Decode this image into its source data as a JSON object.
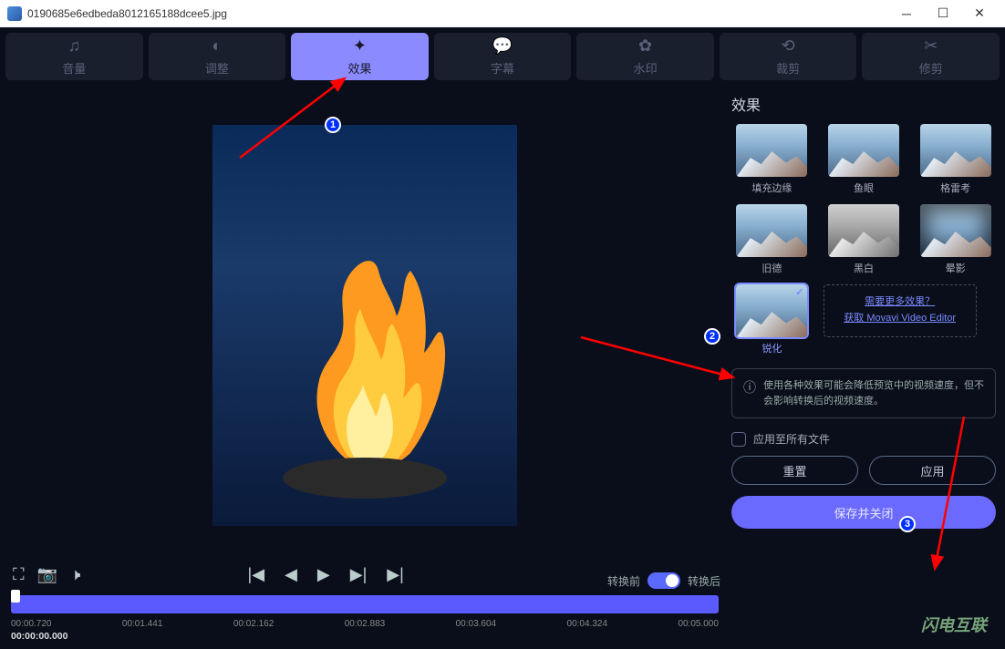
{
  "window": {
    "title": "0190685e6edbeda8012165188dcee5.jpg"
  },
  "tabs": [
    {
      "key": "volume",
      "label": "音量"
    },
    {
      "key": "adjust",
      "label": "调整"
    },
    {
      "key": "effects",
      "label": "效果"
    },
    {
      "key": "subtitle",
      "label": "字幕"
    },
    {
      "key": "watermark",
      "label": "水印"
    },
    {
      "key": "crop",
      "label": "裁剪"
    },
    {
      "key": "trim",
      "label": "修剪"
    }
  ],
  "toggle": {
    "before": "转换前",
    "after": "转换后"
  },
  "panel": {
    "title": "效果",
    "more1": "需要更多效果？",
    "more2": "获取 Movavi Video Editor",
    "notice": "使用各种效果可能会降低预览中的视频速度，但不会影响转换后的视频速度。",
    "applyAll": "应用至所有文件",
    "reset": "重置",
    "apply": "应用",
    "save": "保存并关闭"
  },
  "effects": [
    {
      "key": "fill",
      "label": "填充边缘"
    },
    {
      "key": "fisheye",
      "label": "鱼眼"
    },
    {
      "key": "greco",
      "label": "格雷考"
    },
    {
      "key": "old",
      "label": "旧德"
    },
    {
      "key": "bw",
      "label": "黑白"
    },
    {
      "key": "vignette",
      "label": "晕影"
    },
    {
      "key": "sharpen",
      "label": "锐化"
    }
  ],
  "timeline": {
    "current": "00:00:00.000",
    "ticks": [
      "00:00.720",
      "00:01.441",
      "00:02.162",
      "00:02.883",
      "00:03.604",
      "00:04.324",
      "00:05.000"
    ]
  },
  "watermark": "闪电互联"
}
